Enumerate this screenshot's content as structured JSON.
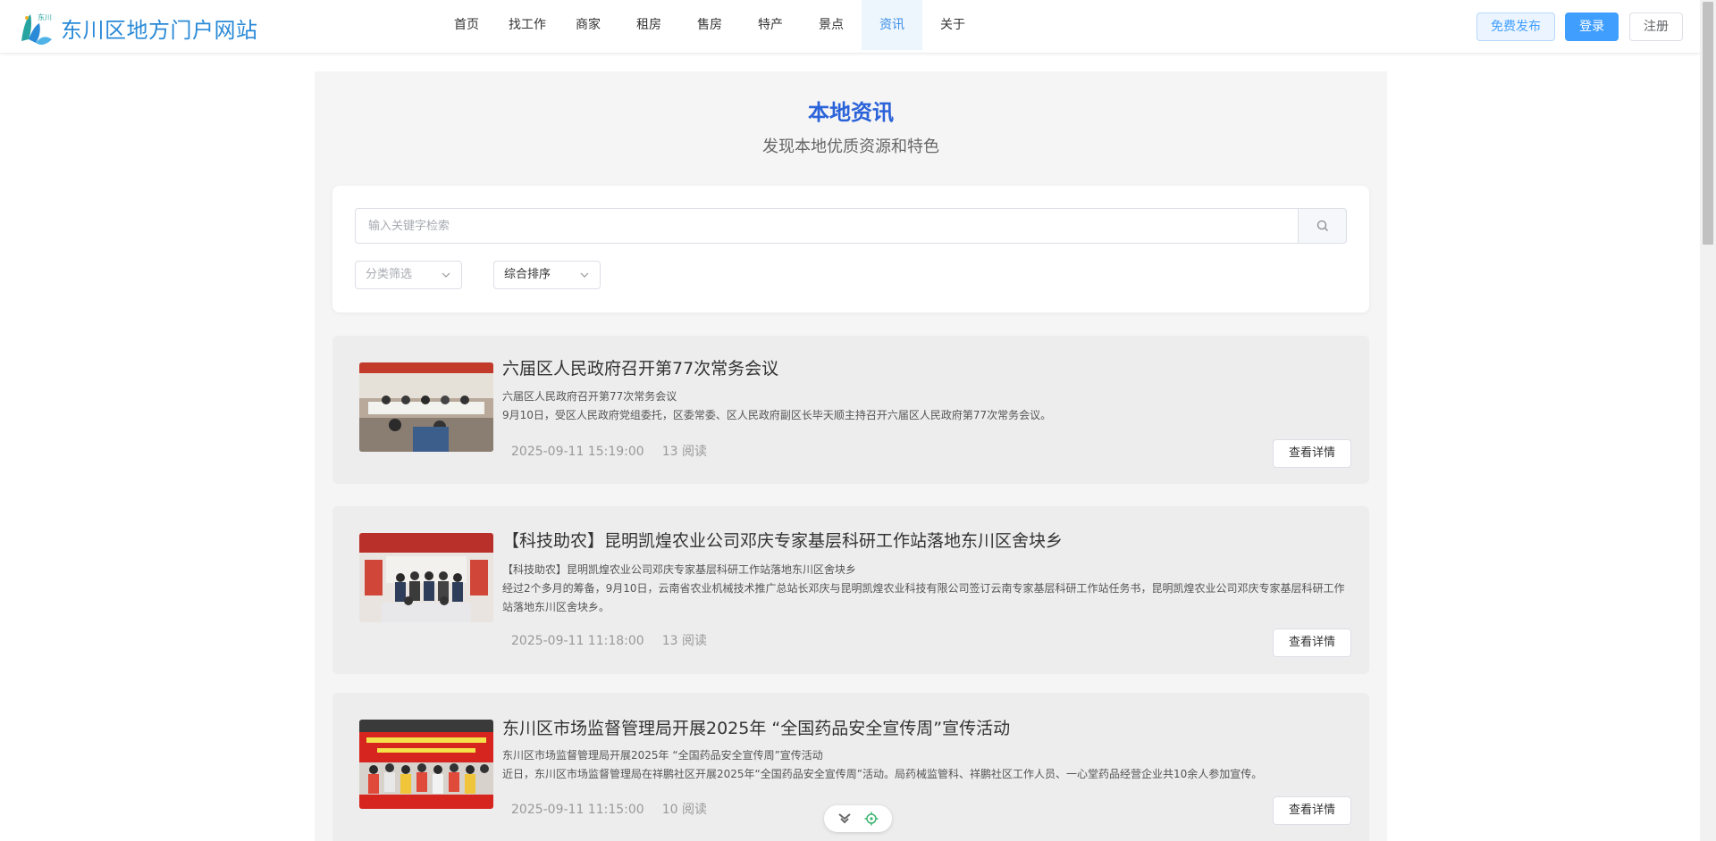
{
  "header": {
    "site_name": "东川区地方门户网站",
    "nav": [
      "首页",
      "找工作",
      "商家",
      "租房",
      "售房",
      "特产",
      "景点",
      "资讯",
      "关于"
    ],
    "active_nav": "资讯",
    "publish_label": "免费发布",
    "login_label": "登录",
    "register_label": "注册"
  },
  "page": {
    "title": "本地资讯",
    "subtitle": "发现本地优质资源和特色"
  },
  "search": {
    "placeholder": "输入关键字检索",
    "value": "",
    "category_placeholder": "分类筛选",
    "sort_value": "综合排序"
  },
  "news": [
    {
      "title": "六届区人民政府召开第77次常务会议",
      "summary_title": "六届区人民政府召开第77次常务会议",
      "summary": "9月10日，受区人民政府党组委托，区委常委、区人民政府副区长毕天顺主持召开六届区人民政府第77次常务会议。",
      "date": "2025-09-11 15:19:00",
      "reads": "13 阅读",
      "detail_label": "查看详情"
    },
    {
      "title": "【科技助农】昆明凯煌农业公司邓庆专家基层科研工作站落地东川区舍块乡",
      "summary_title": "【科技助农】昆明凯煌农业公司邓庆专家基层科研工作站落地东川区舍块乡",
      "summary": "经过2个多月的筹备，9月10日，云南省农业机械技术推广总站长邓庆与昆明凯煌农业科技有限公司签订云南专家基层科研工作站任务书，昆明凯煌农业公司邓庆专家基层科研工作站落地东川区舍块乡。",
      "date": "2025-09-11 11:18:00",
      "reads": "13 阅读",
      "detail_label": "查看详情"
    },
    {
      "title": "东川区市场监督管理局开展2025年 “全国药品安全宣传周”宣传活动",
      "summary_title": "东川区市场监督管理局开展2025年 “全国药品安全宣传周”宣传活动",
      "summary": "近日，东川区市场监督管理局在祥鹏社区开展2025年“全国药品安全宣传周”活动。局药械监管科、祥鹏社区工作人员、一心堂药品经营企业共10余人参加宣传。",
      "date": "2025-09-11 11:15:00",
      "reads": "10 阅读",
      "detail_label": "查看详情"
    }
  ],
  "colors": {
    "accent": "#409eff",
    "title_blue": "#2b63d9",
    "logo_blue": "#2a8ad8"
  }
}
